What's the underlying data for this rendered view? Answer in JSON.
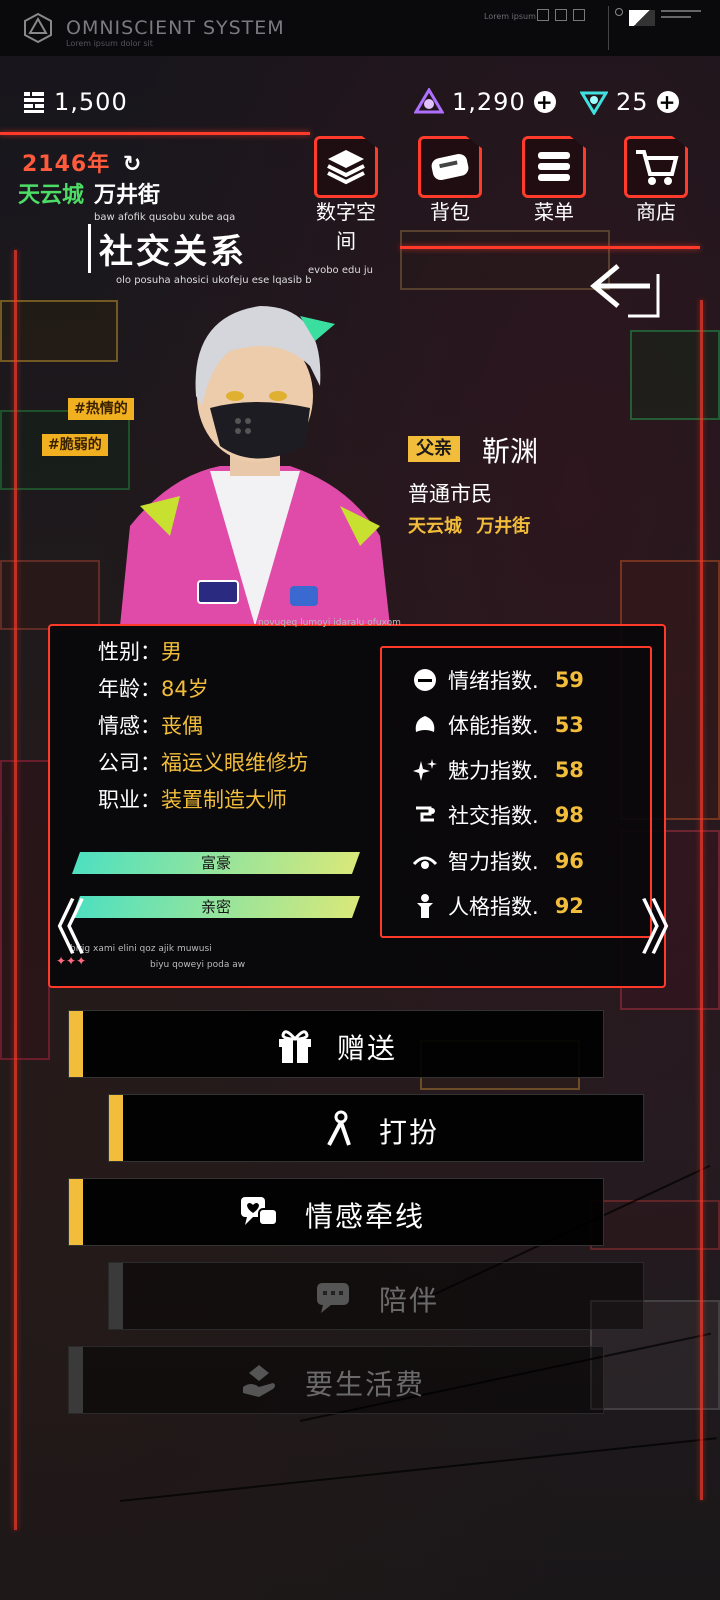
{
  "system": {
    "title": "OMNISCIENT SYSTEM",
    "subtitle": "Lorem ipsum dolor sit",
    "lorem_right": "Lorem ipsum"
  },
  "currency": {
    "coins": "1,500",
    "gems": "1,290",
    "crystals": "25"
  },
  "location": {
    "year": "2146年",
    "city": "天云城",
    "street": "万井街"
  },
  "menu": [
    {
      "label": "数字空间",
      "icon": "layers-icon"
    },
    {
      "label": "背包",
      "icon": "backpack-icon"
    },
    {
      "label": "菜单",
      "icon": "menu-list-icon"
    },
    {
      "label": "商店",
      "icon": "cart-icon"
    }
  ],
  "page": {
    "title": "社交关系",
    "tag_top": "baw afofik qusobu xube aqa",
    "tag_bottom": "olo posuha ahosici ukofeju ese lqasib b",
    "tag_side": "evobo edu ju"
  },
  "character": {
    "traits": [
      "#热情的",
      "#脆弱的"
    ],
    "relation": "父亲",
    "name": "靳渊",
    "class": "普通市民",
    "city": "天云城",
    "street": "万井街"
  },
  "info": {
    "rows": [
      {
        "label": "性别：",
        "value": "男"
      },
      {
        "label": "年龄：",
        "value": "84岁"
      },
      {
        "label": "情感：",
        "value": "丧偶"
      },
      {
        "label": "公司：",
        "value": "福运义眼维修坊"
      },
      {
        "label": "职业：",
        "value": "装置制造大师"
      }
    ],
    "bars": [
      "富豪",
      "亲密"
    ],
    "lorem_top": "novuqeq lumoyi idaralu ofuxom",
    "lorem_bottom1": "birig xami elini qoz ajik muwusi",
    "lorem_bottom2": "biyu qoweyi poda aw"
  },
  "stats": [
    {
      "label": "情绪指数.",
      "value": "59",
      "icon": "mood-icon"
    },
    {
      "label": "体能指数.",
      "value": "53",
      "icon": "muscle-icon"
    },
    {
      "label": "魅力指数.",
      "value": "58",
      "icon": "sparkle-icon"
    },
    {
      "label": "社交指数.",
      "value": "98",
      "icon": "social-icon"
    },
    {
      "label": "智力指数.",
      "value": "96",
      "icon": "eye-icon"
    },
    {
      "label": "人格指数.",
      "value": "92",
      "icon": "person-icon"
    }
  ],
  "actions": [
    {
      "label": "赠送",
      "icon": "gift-icon",
      "enabled": true
    },
    {
      "label": "打扮",
      "icon": "dress-up-icon",
      "enabled": true
    },
    {
      "label": "情感牵线",
      "icon": "chat-heart-icon",
      "enabled": true
    },
    {
      "label": "陪伴",
      "icon": "chat-bubble-icon",
      "enabled": false
    },
    {
      "label": "要生活费",
      "icon": "money-hand-icon",
      "enabled": false
    }
  ],
  "nav": {
    "prev": "《",
    "next": "》"
  },
  "colors": {
    "accent": "#ff3a2a",
    "gold": "#f2bd3a",
    "green": "#4ddc65",
    "year": "#ff5a3c"
  }
}
